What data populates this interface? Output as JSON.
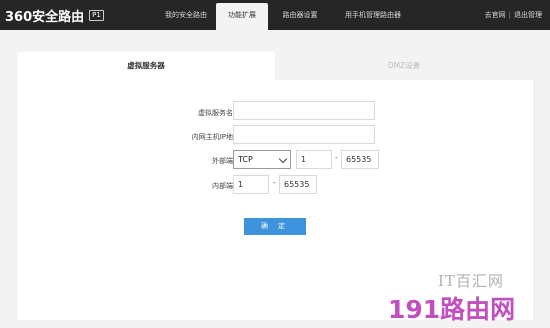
{
  "header": {
    "logo_text": "360安全路由",
    "logo_badge": "P1",
    "nav": [
      "我的安全路由",
      "功能扩展",
      "路由器设置",
      "用手机管理路由器"
    ],
    "links": {
      "official_site": "去官网",
      "separator": "|",
      "logout": "退出管理"
    }
  },
  "tabs": {
    "virtual_server": "虚拟服务器",
    "dmz": "DMZ设置"
  },
  "form": {
    "name_label": "虚拟服务名称",
    "name_value": "",
    "ip_label": "内网主机IP地址",
    "ip_value": "",
    "ext_port_label": "外部端口",
    "protocol": "TCP",
    "ext_port_start": "1",
    "ext_port_end": "65535",
    "int_port_label": "内部端口",
    "int_port_start": "1",
    "int_port_end": "65535",
    "range_sep": "-",
    "confirm_button": "确 定"
  },
  "watermark": {
    "line1": "IT百汇网",
    "line2": "191路由网"
  }
}
